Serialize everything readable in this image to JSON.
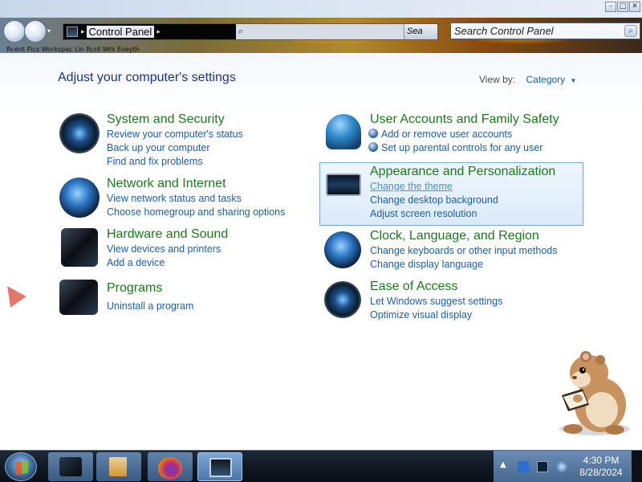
{
  "window": {
    "controls": {
      "minimize": "–",
      "maximize": "□",
      "close": "✕"
    }
  },
  "address_bar": {
    "location": "Control Panel",
    "right_text": "Sea"
  },
  "search": {
    "placeholder": "Search Control Panel",
    "icon": "magnifier-icon"
  },
  "menu_strip": "Rcent Pics Workspac Lin Rcnt Wrk Eveyth",
  "content": {
    "heading": "Adjust your computer's settings",
    "view_by_label": "View by:",
    "view_by_value": "Category"
  },
  "categories": [
    {
      "title": "System and Security",
      "icon": "system-security-icon",
      "links": [
        "Review your computer's status",
        "Back up your computer",
        "Find and fix problems"
      ]
    },
    {
      "title": "Network and Internet",
      "icon": "network-globe-icon",
      "links": [
        "View network status and tasks",
        "Choose homegroup and sharing options"
      ]
    },
    {
      "title": "Hardware and Sound",
      "icon": "hardware-sound-icon",
      "links": [
        "View devices and printers",
        "Add a device"
      ]
    },
    {
      "title": "Programs",
      "icon": "programs-icon",
      "links": [
        "Uninstall a program"
      ]
    },
    {
      "title": "User Accounts and Family Safety",
      "icon": "users-icon",
      "links": [
        "Add or remove user accounts",
        "Set up parental controls for any user"
      ]
    },
    {
      "title": "Appearance and Personalization",
      "icon": "monitor-icon",
      "links": [
        "Change the theme",
        "Change desktop background",
        "Adjust screen resolution"
      ]
    },
    {
      "title": "Clock, Language, and Region",
      "icon": "clock-globe-icon",
      "links": [
        "Change keyboards or other input methods",
        "Change display language"
      ]
    },
    {
      "title": "Ease of Access",
      "icon": "ease-of-access-icon",
      "links": [
        "Let Windows suggest settings",
        "Optimize visual display"
      ]
    }
  ],
  "taskbar": {
    "pinned": [
      "control-panel-app",
      "media-player-app",
      "firefox-app",
      "control-panel-window"
    ],
    "clock_time": "4:30 PM",
    "clock_date": "8/28/2024"
  },
  "colors": {
    "category_title": "#1b7a1b",
    "link": "#1e5fa8",
    "heading": "#1e3287",
    "highlight_border": "#7ba8d6"
  }
}
